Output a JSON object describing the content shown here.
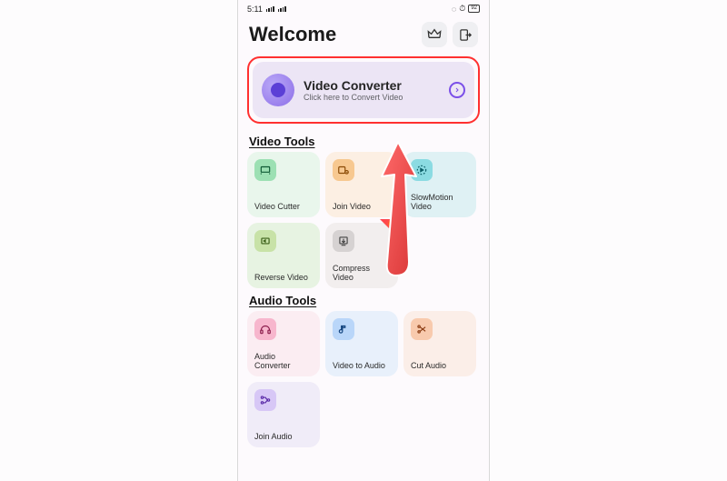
{
  "status": {
    "time": "5:11",
    "battery": "92"
  },
  "header": {
    "title": "Welcome"
  },
  "hero": {
    "title": "Video Converter",
    "subtitle": "Click here to Convert Video"
  },
  "sections": {
    "video_title": "Video Tools",
    "audio_title": "Audio Tools"
  },
  "video_tools": [
    {
      "label": "Video Cutter"
    },
    {
      "label": "Join Video"
    },
    {
      "label": "SlowMotion Video"
    },
    {
      "label": "Reverse Video"
    },
    {
      "label": "Compress Video"
    }
  ],
  "audio_tools": [
    {
      "label": "Audio Converter"
    },
    {
      "label": "Video to Audio"
    },
    {
      "label": "Cut Audio"
    },
    {
      "label": "Join Audio"
    }
  ]
}
